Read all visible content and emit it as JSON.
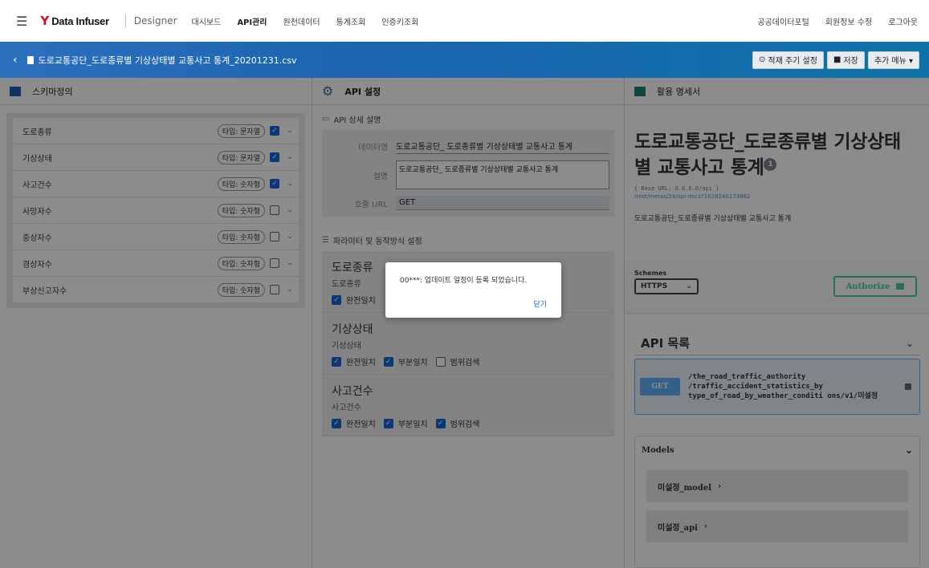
{
  "nav": {
    "logo_text": "Data Infuser",
    "designer": "Designer",
    "items": [
      "대시보드",
      "API관리",
      "원천데이터",
      "통계조회",
      "인증키조회"
    ],
    "right": [
      "공공데이터포털",
      "회원정보 수정",
      "로그아웃"
    ]
  },
  "bar": {
    "file_title": "도로교통공단_도로종류별 기상상태별 교통사고 통계_20201231.csv",
    "cycle_btn": "적재 주기 설정",
    "save_btn": "저장",
    "more_btn": "추가 메뉴 ▾"
  },
  "schema": {
    "title": "스키마정의",
    "rows": [
      {
        "name": "도로종류",
        "type": "타입: 문자열",
        "checked": true
      },
      {
        "name": "기상상태",
        "type": "타입: 문자열",
        "checked": true
      },
      {
        "name": "사고건수",
        "type": "타입: 숫자형",
        "checked": true
      },
      {
        "name": "사망자수",
        "type": "타입: 숫자형",
        "checked": false
      },
      {
        "name": "중상자수",
        "type": "타입: 숫자형",
        "checked": false
      },
      {
        "name": "경상자수",
        "type": "타입: 숫자형",
        "checked": false
      },
      {
        "name": "부상신고자수",
        "type": "타입: 숫자형",
        "checked": false
      }
    ]
  },
  "api": {
    "title": "API 설정",
    "detail_title": "API 상세 설명",
    "data_label": "데이터명",
    "data_value": "도로교통공단_ 도로종류별 기상상태별 교통사고 통계",
    "desc_label": "설명",
    "desc_value": "도로교통공단_ 도로종류별 기상상태별 교통사고 통계",
    "url_label": "호출 URL",
    "url_value": "GET",
    "param_title": "파라미터 및 동작방식 설정",
    "params": [
      {
        "name": "도로종류",
        "sub": "도로종류",
        "opts": [
          {
            "label": "완전일치",
            "checked": true
          }
        ]
      },
      {
        "name": "기상상태",
        "sub": "기상상태",
        "opts": [
          {
            "label": "완전일치",
            "checked": true
          },
          {
            "label": "부분일치",
            "checked": true
          },
          {
            "label": "범위검색",
            "checked": false
          }
        ]
      },
      {
        "name": "사고건수",
        "sub": "사고건수",
        "opts": [
          {
            "label": "완전일치",
            "checked": true
          },
          {
            "label": "부분일치",
            "checked": true
          },
          {
            "label": "범위검색",
            "checked": true
          }
        ]
      }
    ]
  },
  "swagger": {
    "title": "활용 명세서",
    "api_title": "도로교통공단_도로종류별 기상상태별 교통사고 통계",
    "badge": "1",
    "base_url": "[ Base URL: 0.0.0.0/api ]",
    "docs_link": "/rest/metas/24/api-docs?1628240273882",
    "desc": "도로교통공단_도로종류별 기상상태별 교통사고 통계",
    "schemes_label": "Schemes",
    "scheme": "HTTPS",
    "authorize": "Authorize",
    "list_title": "API 목록",
    "method": "GET",
    "path": "/the_road_traffic_authority /traffic_accident_statistics_by type_of_road_by_weather_conditi ons/v1/미설정",
    "models_title": "Models",
    "models": [
      "미설정_model",
      "미설정_api"
    ]
  },
  "dialog": {
    "message": "00***: 업데이트 일정이 등록 되었습니다.",
    "close": "닫기"
  }
}
